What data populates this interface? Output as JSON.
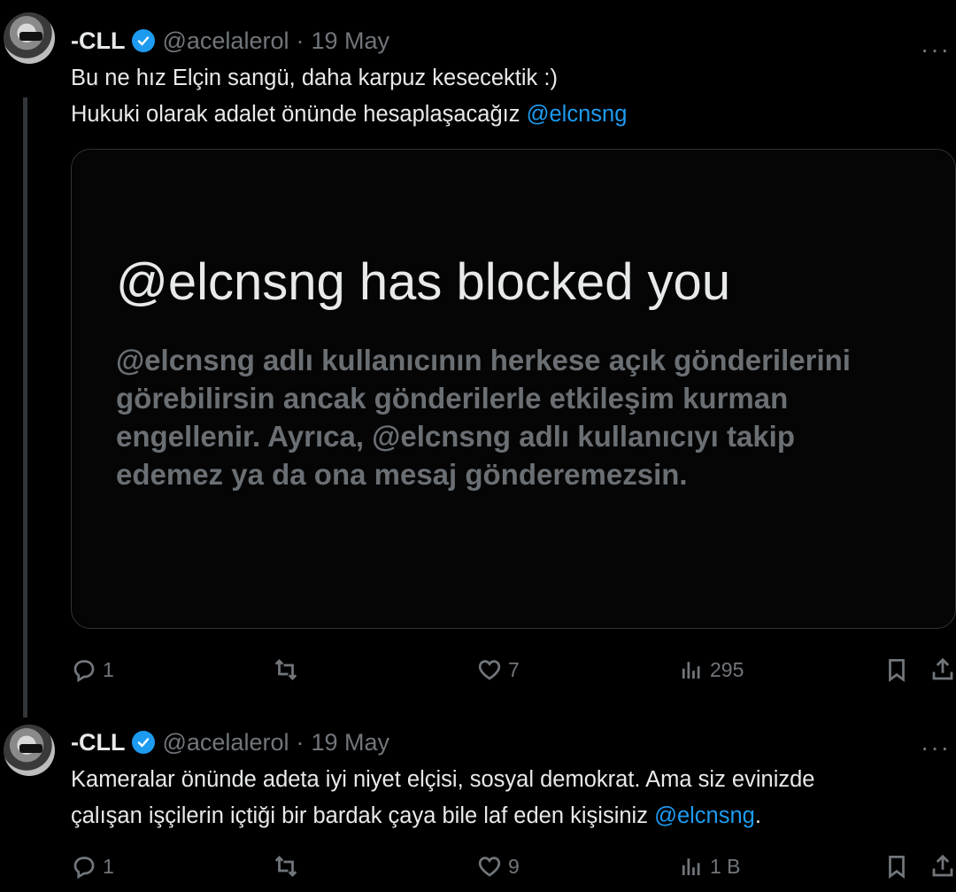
{
  "tweets": [
    {
      "author_name": "-CLL",
      "handle": "@acelalerol",
      "separator": "·",
      "date": "19 May",
      "more_label": "···",
      "text_line1": "Bu ne hız Elçin sangü, daha karpuz kesecektik :)",
      "text_line2": "Hukuki olarak adalet önünde hesaplaşacağız",
      "mention": "@elcnsng",
      "card": {
        "title": "@elcnsng has blocked you",
        "body": "@elcnsng adlı kullanıcının herkese açık gönderilerini görebilirsin ancak gönderilerle etkileşim kurman engellenir. Ayrıca, @elcnsng adlı kullanıcıyı takip edemez ya da ona mesaj gönderemezsin."
      },
      "stats": {
        "replies": "1",
        "retweets": "",
        "likes": "7",
        "views": "295"
      }
    },
    {
      "author_name": "-CLL",
      "handle": "@acelalerol",
      "separator": "·",
      "date": "19 May",
      "more_label": "···",
      "text_line1": "Kameralar önünde adeta iyi niyet elçisi, sosyal demokrat. Ama siz evinizde",
      "text_line2": "çalışan işçilerin içtiği bir bardak çaya bile laf eden kişisiniz",
      "mention": "@elcnsng",
      "text_suffix": ".",
      "stats": {
        "replies": "1",
        "retweets": "",
        "likes": "9",
        "views": "1 B"
      }
    }
  ],
  "icons": {
    "verified": "verified-badge-icon",
    "reply": "reply-icon",
    "retweet": "retweet-icon",
    "like": "heart-icon",
    "views": "views-icon",
    "bookmark": "bookmark-icon",
    "share": "share-icon"
  },
  "colors": {
    "background": "#000000",
    "accent": "#1d9bf0",
    "muted": "#71767b",
    "text": "#e7e9ea"
  }
}
